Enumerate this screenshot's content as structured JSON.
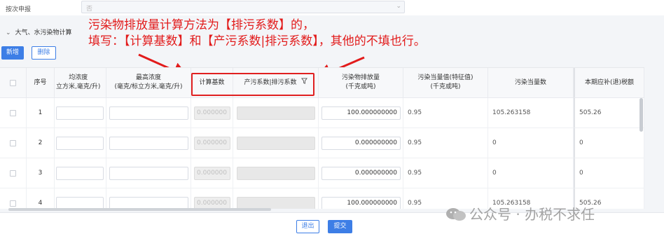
{
  "top": {
    "by_count_label": "按次申报",
    "select_value": "否"
  },
  "section": {
    "title": "大气、水污染物计算"
  },
  "annotation": {
    "line1": "污染物排放量计算方法为【排污系数】的，",
    "line2": "填写：【计算基数】和【产污系数|排污系数】，其他的不填也行。"
  },
  "buttons": {
    "add": "新增",
    "delete": "删除",
    "exit": "退出",
    "submit": "提交"
  },
  "columns": {
    "index": "序号",
    "avg_conc_a": "均浓度",
    "avg_conc_b": "立方米,毫克/升)",
    "max_conc_a": "最高浓度",
    "max_conc_b": "(毫克/标立方米,毫克/升)",
    "calc_base": "计算基数",
    "coef": "产污系数|排污系数",
    "emission_a": "污染物排放量",
    "emission_b": "(千克或吨)",
    "equiv_val_a": "污染当量值(特征值)",
    "equiv_val_b": "(千克或吨)",
    "equiv_num": "污染当量数",
    "tax": "本期应补(退)税额"
  },
  "rows": [
    {
      "index": "1",
      "calc_base": "0.000000",
      "emission": "100.000000000",
      "equiv_val": "0.95",
      "equiv_num": "105.263158",
      "tax": "505.26"
    },
    {
      "index": "2",
      "calc_base": "0.000000",
      "emission": "0.000000000",
      "equiv_val": "0.95",
      "equiv_num": "0",
      "tax": "0"
    },
    {
      "index": "3",
      "calc_base": "0.000000",
      "emission": "0.000000000",
      "equiv_val": "0.95",
      "equiv_num": "0",
      "tax": "0"
    },
    {
      "index": "4",
      "calc_base": "0.000000",
      "emission": "100.000000000",
      "equiv_val": "0.95",
      "equiv_num": "105.263158",
      "tax": "505.26"
    }
  ],
  "watermark": {
    "text": "公众号 · 办税不求任"
  },
  "icons": {
    "filter": "filter-icon",
    "chevron": "chevron-down-icon",
    "select_arrow": "select-arrow-icon",
    "wechat": "wechat-logo"
  },
  "colors": {
    "accent": "#3d7ee6",
    "annotation": "#e21b1b"
  }
}
